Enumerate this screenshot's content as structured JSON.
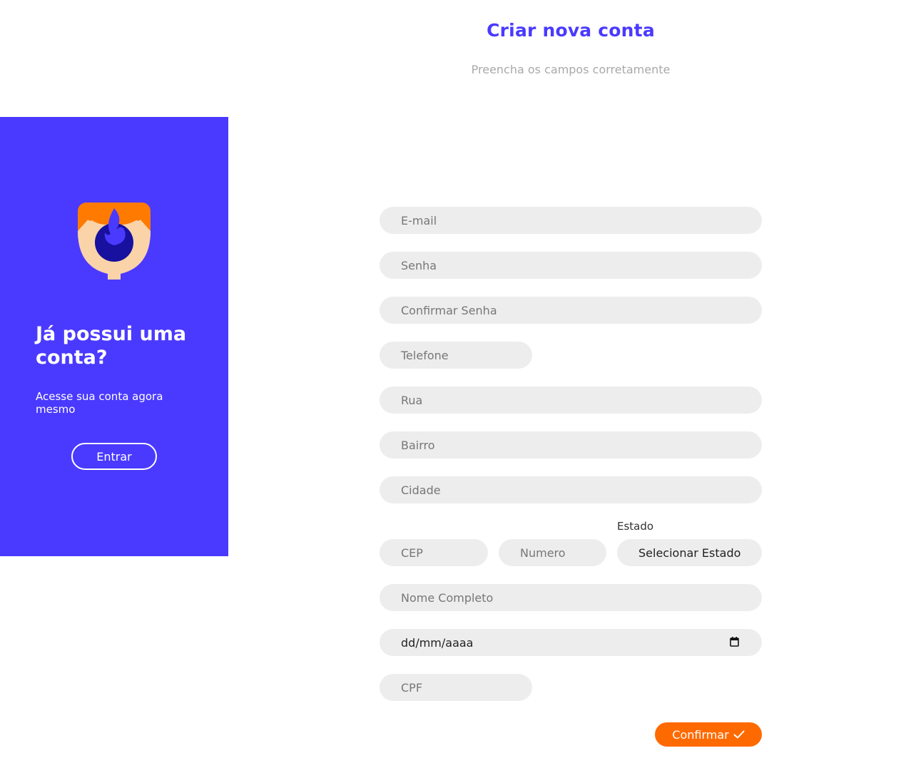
{
  "header": {
    "title": "Criar nova conta",
    "subtitle": "Preencha os campos corretamente"
  },
  "side_panel": {
    "logo_icon": "flame-shield-icon",
    "heading": "Já possui uma conta?",
    "text": "Acesse sua conta agora mesmo",
    "enter_label": "Entrar"
  },
  "form": {
    "email_placeholder": "E-mail",
    "password_placeholder": "Senha",
    "confirm_password_placeholder": "Confirmar Senha",
    "phone_placeholder": "Telefone",
    "street_placeholder": "Rua",
    "neighborhood_placeholder": "Bairro",
    "city_placeholder": "Cidade",
    "cep_placeholder": "CEP",
    "number_placeholder": "Numero",
    "state_label": "Estado",
    "state_selected": "Selecionar Estado",
    "full_name_placeholder": "Nome Completo",
    "birthdate_value": "dd/mm/aaaa",
    "cpf_placeholder": "CPF",
    "confirm_label": "Confirmar"
  },
  "colors": {
    "primary": "#4a3aff",
    "accent": "#ff6a00",
    "field_bg": "#ededed"
  }
}
